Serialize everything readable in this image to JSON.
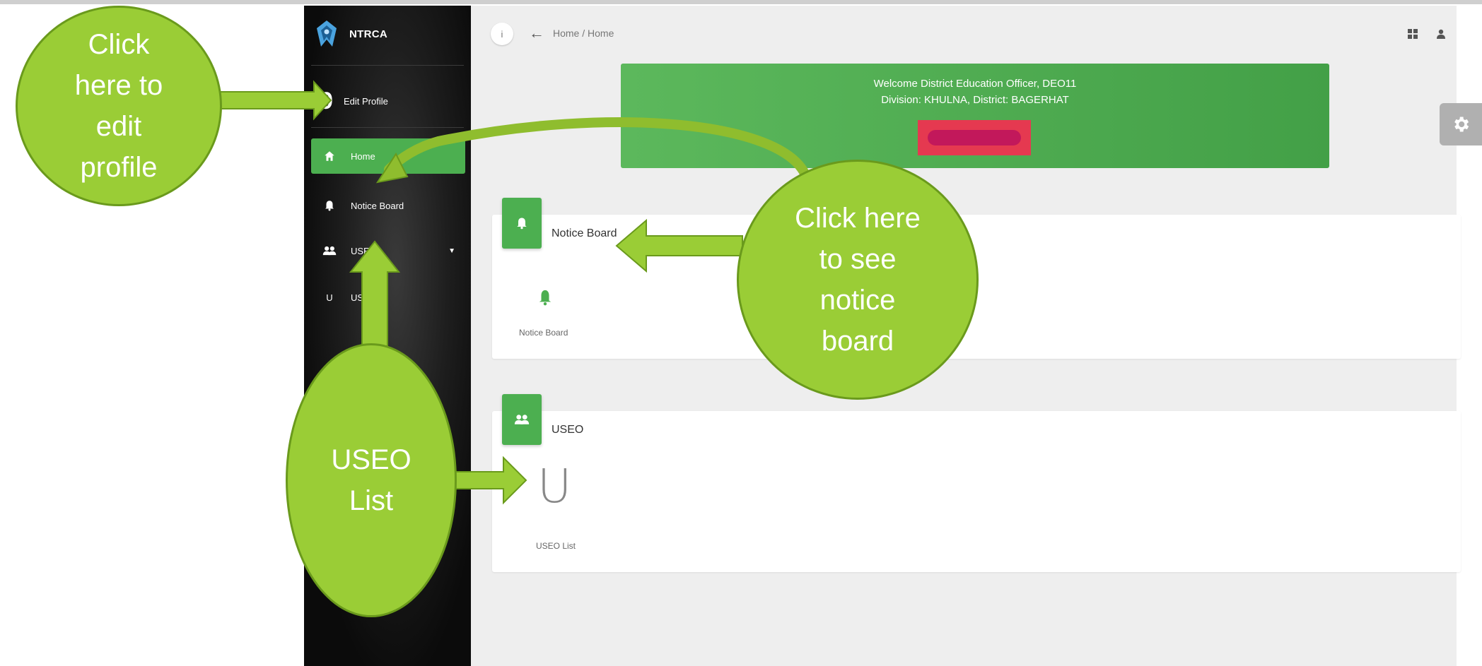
{
  "sidebar": {
    "brand": "NTRCA",
    "profile": {
      "glyph": "9",
      "label": "Edit Profile"
    },
    "items": [
      {
        "label": "Home"
      },
      {
        "label": "Notice Board"
      },
      {
        "label": "USEO"
      },
      {
        "label": "USE"
      }
    ]
  },
  "topbar": {
    "info_glyph": "i",
    "breadcrumb": "Home / Home"
  },
  "welcome": {
    "line1": "Welcome District Education Officer, DEO11",
    "line2": "Division: KHULNA, District: BAGERHAT"
  },
  "cards": {
    "notice": {
      "title": "Notice Board",
      "tile_label": "Notice Board"
    },
    "useo": {
      "title": "USEO",
      "tile_glyph": "U",
      "tile_label": "USEO List"
    }
  },
  "annotations": {
    "edit_profile": [
      "Click",
      "here to",
      "edit",
      "profile"
    ],
    "notice_board": [
      "Click here",
      "to see",
      "notice",
      "board"
    ],
    "useo_list": [
      "USEO",
      "List"
    ]
  },
  "colors": {
    "accent_green": "#4caf50",
    "bubble_green": "#9acd36",
    "highlight_red": "#e53950"
  }
}
